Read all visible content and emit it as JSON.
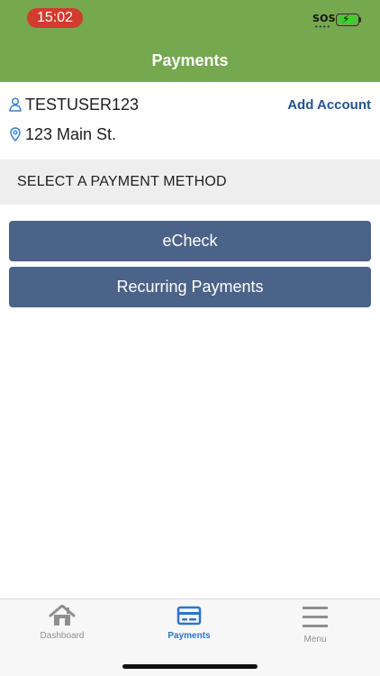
{
  "status": {
    "time": "15:02",
    "carrier": "SOS"
  },
  "header": {
    "title": "Payments"
  },
  "account": {
    "username": "TESTUSER123",
    "address": "123 Main St.",
    "add_account_label": "Add Account"
  },
  "section": {
    "title": "SELECT A PAYMENT METHOD"
  },
  "payment_methods": [
    {
      "label": "eCheck"
    },
    {
      "label": "Recurring Payments"
    }
  ],
  "tabs": [
    {
      "label": "Dashboard",
      "icon": "home-icon"
    },
    {
      "label": "Payments",
      "icon": "card-icon",
      "active": true
    },
    {
      "label": "Menu",
      "icon": "menu-icon"
    }
  ],
  "colors": {
    "header_green": "#75a84f",
    "button_blue": "#4b6388",
    "accent_blue": "#24548f",
    "tab_active": "#2d76c8",
    "status_red": "#d33b2f"
  }
}
